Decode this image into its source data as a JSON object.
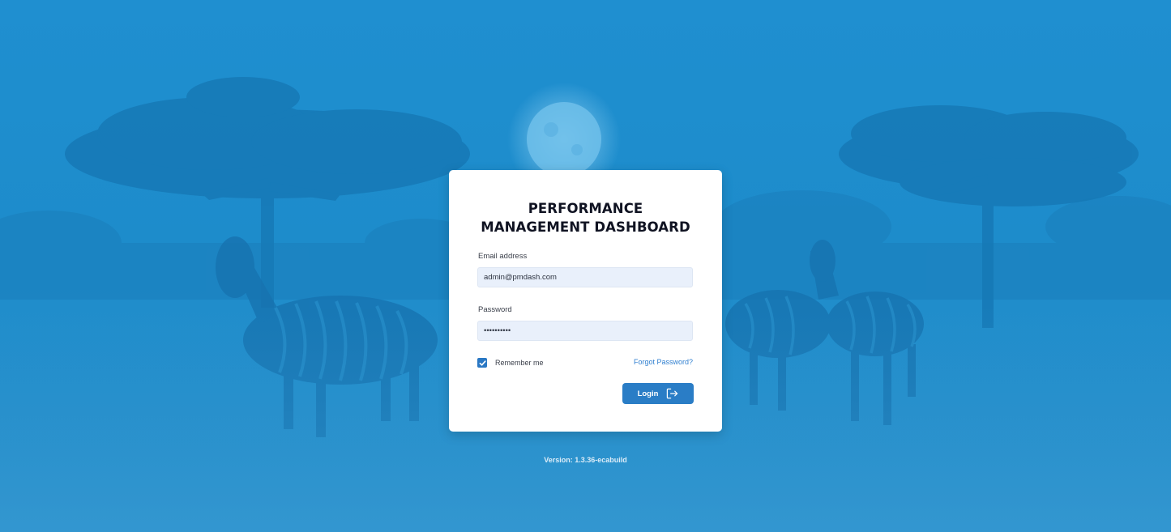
{
  "background": {
    "scene": "savanna-night-zebras",
    "overlay_color": "#1f8fd0"
  },
  "login": {
    "title_line1": "PERFORMANCE",
    "title_line2": "MANAGEMENT DASHBOARD",
    "email_label": "Email address",
    "email_value": "admin@pmdash.com",
    "password_label": "Password",
    "password_value": "••••••••••",
    "remember_label": "Remember me",
    "remember_checked": true,
    "forgot_label": "Forgot Password?",
    "login_button_label": "Login",
    "login_icon": "sign-in-icon"
  },
  "footer": {
    "version": "Version: 1.3.36-ecabuild"
  },
  "colors": {
    "accent": "#2a7dc6",
    "link": "#2f7fd0",
    "card_background": "#ffffff",
    "input_background": "#e9f0fb"
  }
}
